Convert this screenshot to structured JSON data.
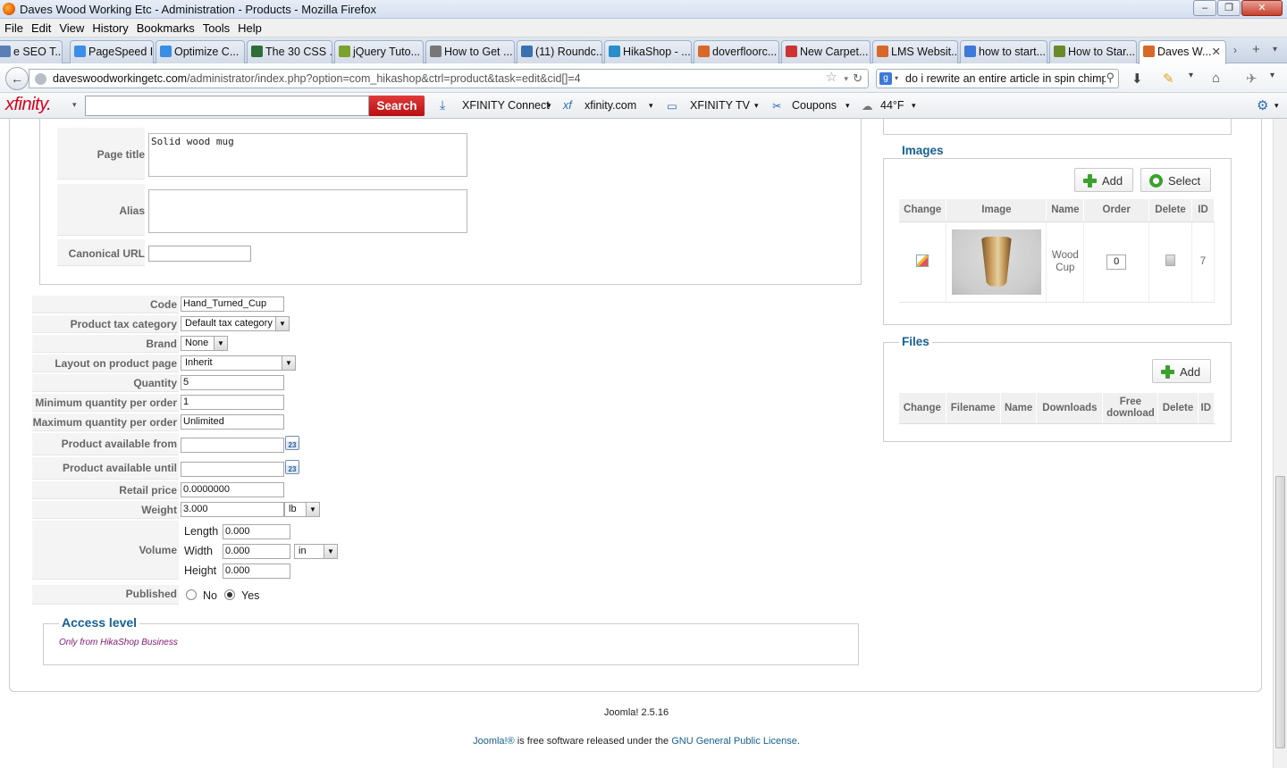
{
  "window": {
    "title": "Daves Wood Working Etc - Administration - Products - Mozilla Firefox"
  },
  "menu": [
    "File",
    "Edit",
    "View",
    "History",
    "Bookmarks",
    "Tools",
    "Help"
  ],
  "tabs": [
    {
      "label": "e SEO T...",
      "color": "#5a7fb5"
    },
    {
      "label": "PageSpeed I...",
      "color": "#3b8ee5"
    },
    {
      "label": "Optimize C...",
      "color": "#3b8ee5"
    },
    {
      "label": "The 30 CSS ...",
      "color": "#2d6e3a"
    },
    {
      "label": "jQuery Tuto...",
      "color": "#7aa22c"
    },
    {
      "label": "How to Get ...",
      "color": "#777"
    },
    {
      "label": "(11) Roundc...",
      "color": "#3a6fb0"
    },
    {
      "label": "HikaShop - ...",
      "color": "#2a8fc9"
    },
    {
      "label": "doverfloorc...",
      "color": "#d8682a"
    },
    {
      "label": "New Carpet...",
      "color": "#c33"
    },
    {
      "label": "LMS Websit...",
      "color": "#d8682a"
    },
    {
      "label": "how to start...",
      "color": "#3d79d8"
    },
    {
      "label": "How to Star...",
      "color": "#6a8a2a"
    },
    {
      "label": "Daves W...",
      "color": "#d8682a"
    }
  ],
  "nav": {
    "url_domain": "daveswoodworkingetc.com",
    "url_path": "/administrator/index.php?option=com_hikashop&ctrl=product&task=edit&cid[]=4",
    "search_text": "do i rewrite an entire article in spin chimp",
    "search_engine_icon": "g-icon"
  },
  "toolbar": {
    "logo": "xfinity.",
    "search_button": "Search",
    "links": [
      "XFINITY Connect",
      "xfinity.com",
      "XFINITY TV",
      "Coupons",
      "44°F"
    ]
  },
  "meta": {
    "page_title_label": "Page title",
    "page_title_value": "Solid wood mug",
    "alias_label": "Alias",
    "alias_value": "",
    "canonical_label": "Canonical URL",
    "canonical_value": ""
  },
  "form": {
    "code_label": "Code",
    "code_value": "Hand_Turned_Cup",
    "tax_label": "Product tax category",
    "tax_value": "Default tax category",
    "brand_label": "Brand",
    "brand_value": "None",
    "layout_label": "Layout on product page",
    "layout_value": "Inherit",
    "quantity_label": "Quantity",
    "quantity_value": "5",
    "min_label": "Minimum quantity per order",
    "min_value": "1",
    "max_label": "Maximum quantity per order",
    "max_value": "Unlimited",
    "avail_from_label": "Product available from",
    "avail_from_value": "",
    "avail_until_label": "Product available until",
    "avail_until_value": "",
    "calendar_label": "23",
    "retail_label": "Retail price",
    "retail_value": "0.0000000",
    "weight_label": "Weight",
    "weight_value": "3.000",
    "weight_unit": "lb",
    "volume_label": "Volume",
    "length_label": "Length",
    "length_value": "0.000",
    "width_label": "Width",
    "width_value": "0.000",
    "dim_unit": "in",
    "height_label": "Height",
    "height_value": "0.000",
    "published_label": "Published",
    "published_no": "No",
    "published_yes": "Yes"
  },
  "access": {
    "legend": "Access level",
    "text": "Only from HikaShop Business"
  },
  "images": {
    "legend": "Images",
    "add_button": "Add",
    "select_button": "Select",
    "columns": [
      "Change",
      "Image",
      "Name",
      "Order",
      "Delete",
      "ID"
    ],
    "rows": [
      {
        "name_line1": "Wood",
        "name_line2": "Cup",
        "order": "0",
        "id": "7"
      }
    ]
  },
  "files": {
    "legend": "Files",
    "add_button": "Add",
    "columns": [
      "Change",
      "Filename",
      "Name",
      "Downloads",
      "Free download",
      "Delete",
      "ID"
    ]
  },
  "footer": {
    "version": "Joomla! 2.5.16",
    "license_prefix": "Joomla!®",
    "license_mid": " is free software released under the ",
    "license_link": "GNU General Public License",
    "license_suffix": "."
  }
}
